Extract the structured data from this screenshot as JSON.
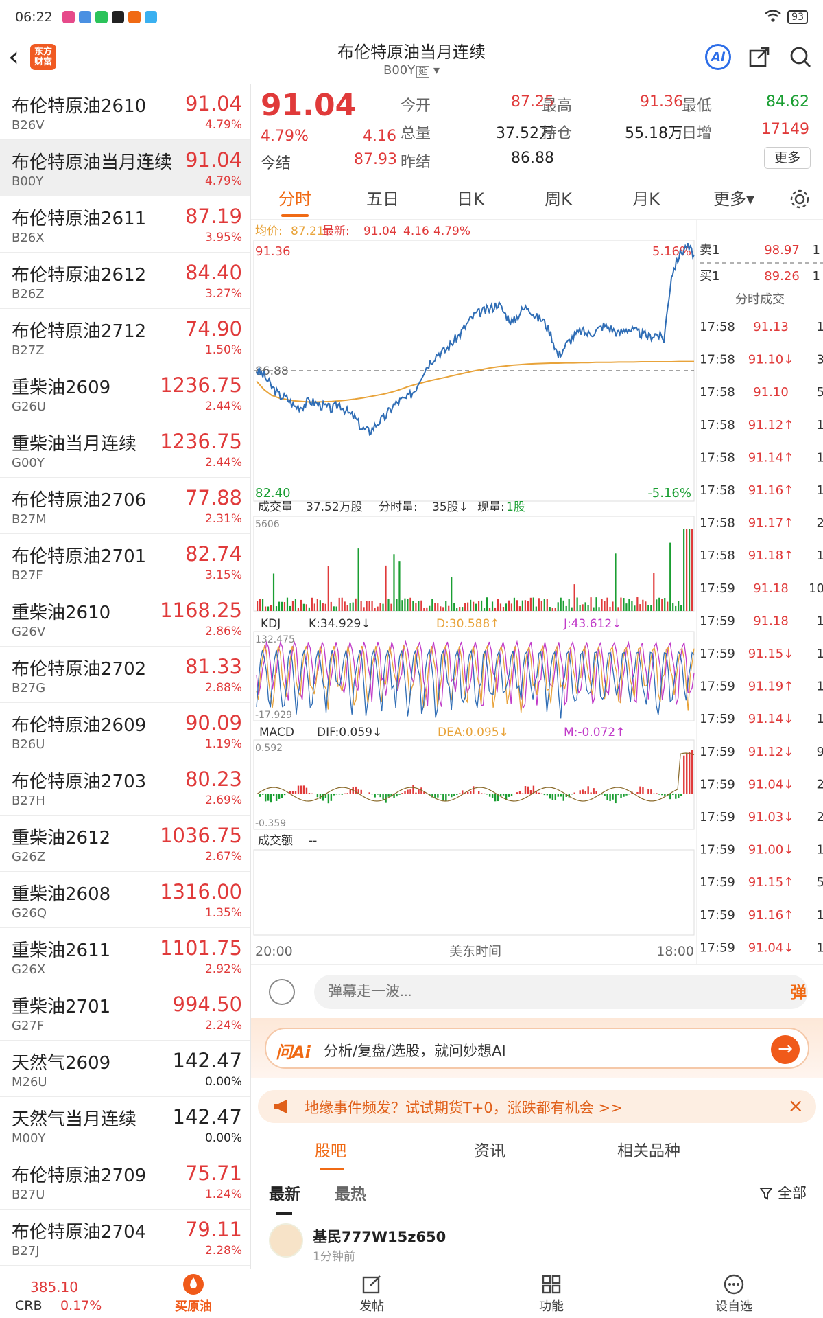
{
  "status": {
    "time": "06:22",
    "battery": "93",
    "app_colors": [
      "#e64a8a",
      "#4a90e2",
      "#2bc35a",
      "#222222",
      "#f06a14",
      "#3ab0f0"
    ]
  },
  "header": {
    "title": "布伦特原油当月连续",
    "subtitle": "B00Y",
    "tag": "延",
    "ai_label": "Ai",
    "logo_text_1": "东方",
    "logo_text_2": "财富"
  },
  "sidebar": [
    {
      "name": "布伦特原油2610",
      "code": "B26V",
      "price": "91.04",
      "pct": "4.79%",
      "color": "red",
      "active": false
    },
    {
      "name": "布伦特原油当月连续",
      "code": "B00Y",
      "price": "91.04",
      "pct": "4.79%",
      "color": "red",
      "active": true
    },
    {
      "name": "布伦特原油2611",
      "code": "B26X",
      "price": "87.19",
      "pct": "3.95%",
      "color": "red",
      "active": false
    },
    {
      "name": "布伦特原油2612",
      "code": "B26Z",
      "price": "84.40",
      "pct": "3.27%",
      "color": "red",
      "active": false
    },
    {
      "name": "布伦特原油2712",
      "code": "B27Z",
      "price": "74.90",
      "pct": "1.50%",
      "color": "red",
      "active": false
    },
    {
      "name": "重柴油2609",
      "code": "G26U",
      "price": "1236.75",
      "pct": "2.44%",
      "color": "red",
      "active": false
    },
    {
      "name": "重柴油当月连续",
      "code": "G00Y",
      "price": "1236.75",
      "pct": "2.44%",
      "color": "red",
      "active": false
    },
    {
      "name": "布伦特原油2706",
      "code": "B27M",
      "price": "77.88",
      "pct": "2.31%",
      "color": "red",
      "active": false
    },
    {
      "name": "布伦特原油2701",
      "code": "B27F",
      "price": "82.74",
      "pct": "3.15%",
      "color": "red",
      "active": false
    },
    {
      "name": "重柴油2610",
      "code": "G26V",
      "price": "1168.25",
      "pct": "2.86%",
      "color": "red",
      "active": false
    },
    {
      "name": "布伦特原油2702",
      "code": "B27G",
      "price": "81.33",
      "pct": "2.88%",
      "color": "red",
      "active": false
    },
    {
      "name": "布伦特原油2609",
      "code": "B26U",
      "price": "90.09",
      "pct": "1.19%",
      "color": "red",
      "active": false
    },
    {
      "name": "布伦特原油2703",
      "code": "B27H",
      "price": "80.23",
      "pct": "2.69%",
      "color": "red",
      "active": false
    },
    {
      "name": "重柴油2612",
      "code": "G26Z",
      "price": "1036.75",
      "pct": "2.67%",
      "color": "red",
      "active": false
    },
    {
      "name": "重柴油2608",
      "code": "G26Q",
      "price": "1316.00",
      "pct": "1.35%",
      "color": "red",
      "active": false
    },
    {
      "name": "重柴油2611",
      "code": "G26X",
      "price": "1101.75",
      "pct": "2.92%",
      "color": "red",
      "active": false
    },
    {
      "name": "重柴油2701",
      "code": "G27F",
      "price": "994.50",
      "pct": "2.24%",
      "color": "red",
      "active": false
    },
    {
      "name": "天然气2609",
      "code": "M26U",
      "price": "142.47",
      "pct": "0.00%",
      "color": "black",
      "active": false
    },
    {
      "name": "天然气当月连续",
      "code": "M00Y",
      "price": "142.47",
      "pct": "0.00%",
      "color": "black",
      "active": false
    },
    {
      "name": "布伦特原油2709",
      "code": "B27U",
      "price": "75.71",
      "pct": "1.24%",
      "color": "red",
      "active": false
    },
    {
      "name": "布伦特原油2704",
      "code": "B27J",
      "price": "79.11",
      "pct": "2.28%",
      "color": "red",
      "active": false
    }
  ],
  "quote": {
    "price": "91.04",
    "pct": "4.79%",
    "change": "4.16",
    "settle_label": "今结",
    "settle": "87.93",
    "open_label": "今开",
    "open": "87.25",
    "high_label": "最高",
    "high": "91.36",
    "low_label": "最低",
    "low": "84.62",
    "vol_label": "总量",
    "vol": "37.52万",
    "oi_label": "持仓",
    "oi": "55.18万",
    "daily_label": "日增",
    "daily": "17149",
    "prev_label": "昨结",
    "prev": "86.88",
    "more": "更多"
  },
  "tabs": [
    {
      "label": "分时",
      "active": true
    },
    {
      "label": "五日",
      "active": false
    },
    {
      "label": "日K",
      "active": false
    },
    {
      "label": "周K",
      "active": false
    },
    {
      "label": "月K",
      "active": false
    },
    {
      "label": "更多▾",
      "active": false
    }
  ],
  "chart_data": {
    "type": "line",
    "avg_label": "均价:",
    "avg": "87.21",
    "latest_label": "最新:",
    "latest": "91.04",
    "chg": "4.16",
    "pct": "4.79%",
    "y_max": "91.36",
    "y_min": "82.40",
    "pct_max": "5.16%",
    "pct_min": "-5.16%",
    "prev_close": "86.88",
    "ylim": [
      82.4,
      91.36
    ],
    "x_start": "20:00",
    "x_mid": "美东时间",
    "x_end": "18:00",
    "series": [
      {
        "values": [
          86.9,
          86.7,
          86.3,
          86.0,
          85.9,
          85.6,
          85.6,
          85.8,
          85.7,
          85.6,
          85.5,
          85.7,
          85.4,
          85.2,
          84.8,
          84.7,
          85.0,
          85.2,
          85.6,
          85.8,
          85.9,
          86.2,
          86.8,
          87.2,
          87.5,
          87.6,
          87.9,
          88.2,
          88.6,
          88.9,
          89.0,
          89.1,
          89.3,
          88.9,
          88.6,
          89.0,
          89.2,
          88.8,
          88.7,
          88.2,
          87.4,
          87.8,
          88.1,
          88.3,
          88.2,
          88.3,
          88.5,
          88.4,
          88.2,
          88.4,
          88.3,
          88.2,
          88.1,
          88.2,
          88.0,
          90.3,
          91.0,
          91.36,
          91.04
        ]
      },
      {
        "values": [
          86.5,
          86.2,
          86.0,
          85.9,
          85.85,
          85.8,
          85.78,
          85.76,
          85.76,
          85.77,
          85.78,
          85.8,
          85.83,
          85.86,
          85.9,
          85.95,
          86.0,
          86.05,
          86.12,
          86.2,
          86.3,
          86.38,
          86.45,
          86.52,
          86.58,
          86.64,
          86.7,
          86.76,
          86.82,
          86.88,
          86.93,
          86.98,
          87.02,
          87.05,
          87.08,
          87.1,
          87.12,
          87.13,
          87.14,
          87.15,
          87.15,
          87.16,
          87.16,
          87.17,
          87.17,
          87.18,
          87.18,
          87.18,
          87.19,
          87.19,
          87.19,
          87.2,
          87.2,
          87.2,
          87.2,
          87.2,
          87.21,
          87.21,
          87.21
        ]
      }
    ]
  },
  "indicators": {
    "vol_label": "成交量",
    "vol_total": "37.52万股",
    "vol_min_label": "分时量:",
    "vol_min": "35股↓",
    "vol_now_label": "现量:",
    "vol_now": "1股",
    "vol_max": "5606",
    "kdj_label": "KDJ",
    "k": "K:34.929↓",
    "d": "D:30.588↑",
    "j": "J:43.612↓",
    "kdj_max": "132.475",
    "kdj_min": "-17.929",
    "macd_label": "MACD",
    "dif": "DIF:0.059↓",
    "dea": "DEA:0.095↓",
    "m": "M:-0.072↑",
    "macd_max": "0.592",
    "macd_min": "-0.359",
    "amt_label": "成交额",
    "amt_val": "--"
  },
  "orderbook": {
    "sell_label": "卖1",
    "sell_price": "98.97",
    "sell_qty": "1",
    "buy_label": "买1",
    "buy_price": "89.26",
    "buy_qty": "1",
    "ticks_title": "分时成交",
    "ticks": [
      {
        "t": "17:58",
        "p": "91.13",
        "q": "1"
      },
      {
        "t": "17:58",
        "p": "91.10↓",
        "q": "3"
      },
      {
        "t": "17:58",
        "p": "91.10",
        "q": "5"
      },
      {
        "t": "17:58",
        "p": "91.12↑",
        "q": "1"
      },
      {
        "t": "17:58",
        "p": "91.14↑",
        "q": "1"
      },
      {
        "t": "17:58",
        "p": "91.16↑",
        "q": "1"
      },
      {
        "t": "17:58",
        "p": "91.17↑",
        "q": "2"
      },
      {
        "t": "17:58",
        "p": "91.18↑",
        "q": "1"
      },
      {
        "t": "17:59",
        "p": "91.18",
        "q": "10"
      },
      {
        "t": "17:59",
        "p": "91.18",
        "q": "1"
      },
      {
        "t": "17:59",
        "p": "91.15↓",
        "q": "1"
      },
      {
        "t": "17:59",
        "p": "91.19↑",
        "q": "1"
      },
      {
        "t": "17:59",
        "p": "91.14↓",
        "q": "1"
      },
      {
        "t": "17:59",
        "p": "91.12↓",
        "q": "9"
      },
      {
        "t": "17:59",
        "p": "91.04↓",
        "q": "2"
      },
      {
        "t": "17:59",
        "p": "91.03↓",
        "q": "2"
      },
      {
        "t": "17:59",
        "p": "91.00↓",
        "q": "1"
      },
      {
        "t": "17:59",
        "p": "91.15↑",
        "q": "5"
      },
      {
        "t": "17:59",
        "p": "91.16↑",
        "q": "1"
      },
      {
        "t": "17:59",
        "p": "91.04↓",
        "q": "1"
      }
    ]
  },
  "compose": {
    "placeholder": "弹幕走一波...",
    "danmu_btn": "弹"
  },
  "ai": {
    "logo": "问Ai",
    "text": "分析/复盘/选股，就问妙想AI",
    "go": "→"
  },
  "notice": {
    "text": "地缘事件频发？试试期货T+0，涨跌都有机会 >>",
    "close": "×"
  },
  "subtabs": [
    {
      "label": "股吧",
      "active": true
    },
    {
      "label": "资讯",
      "active": false
    },
    {
      "label": "相关品种",
      "active": false
    }
  ],
  "filter": {
    "latest": "最新",
    "hot": "最热",
    "all": "全部"
  },
  "post": {
    "user": "基民777W15z650",
    "time": "1分钟前"
  },
  "bottom": {
    "crb_value": "385.10",
    "crb_name": "CRB",
    "crb_pct": "0.17%",
    "nav": [
      {
        "label": "买原油",
        "active": true
      },
      {
        "label": "发帖",
        "active": false
      },
      {
        "label": "功能",
        "active": false
      },
      {
        "label": "设自选",
        "active": false
      }
    ]
  }
}
